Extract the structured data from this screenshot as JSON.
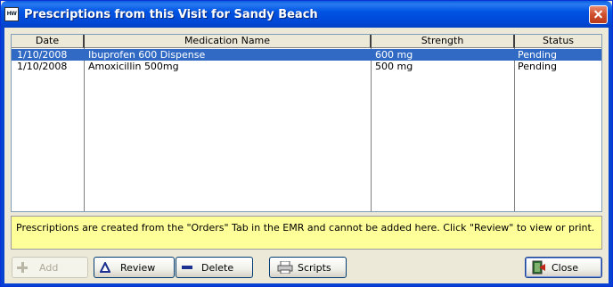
{
  "window": {
    "title": "Prescriptions from this Visit for Sandy Beach"
  },
  "grid": {
    "columns": [
      "Date",
      "Medication Name",
      "Strength",
      "Status"
    ],
    "rows": [
      {
        "date": "1/10/2008",
        "medication": "Ibuprofen 600 Dispense",
        "strength": "600 mg",
        "status": "Pending",
        "selected": true
      },
      {
        "date": "1/10/2008",
        "medication": "Amoxicillin 500mg",
        "strength": "500 mg",
        "status": "Pending",
        "selected": false
      }
    ]
  },
  "info_text": "Prescriptions are created from the \"Orders\" Tab in the EMR and cannot be added here. Click \"Review\" to view or print.",
  "buttons": {
    "add": {
      "label": "Add",
      "enabled": false
    },
    "review": {
      "label": "Review"
    },
    "delete": {
      "label": "Delete"
    },
    "scripts": {
      "label": "Scripts"
    },
    "close": {
      "label": "Close"
    }
  },
  "colors": {
    "selection": "#316ac5",
    "info_background": "#ffff99",
    "title_bar": "#0054e3"
  }
}
